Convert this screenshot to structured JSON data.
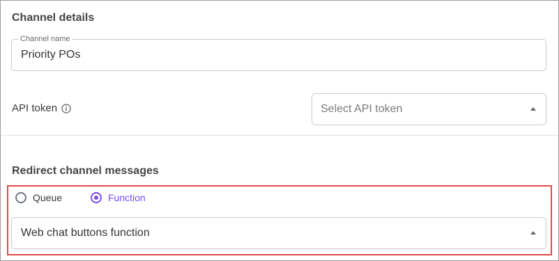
{
  "channel_details": {
    "title": "Channel details",
    "channel_name": {
      "label": "Channel name",
      "value": "Priority POs"
    },
    "api_token": {
      "label": "API token",
      "placeholder": "Select API token",
      "icon": "info-icon"
    }
  },
  "redirect": {
    "title": "Redirect channel messages",
    "options": [
      {
        "label": "Queue",
        "selected": false
      },
      {
        "label": "Function",
        "selected": true
      }
    ],
    "function_select": {
      "value": "Web chat buttons function"
    }
  },
  "colors": {
    "accent": "#7b4cf0",
    "highlight_border": "#e04a4a"
  }
}
